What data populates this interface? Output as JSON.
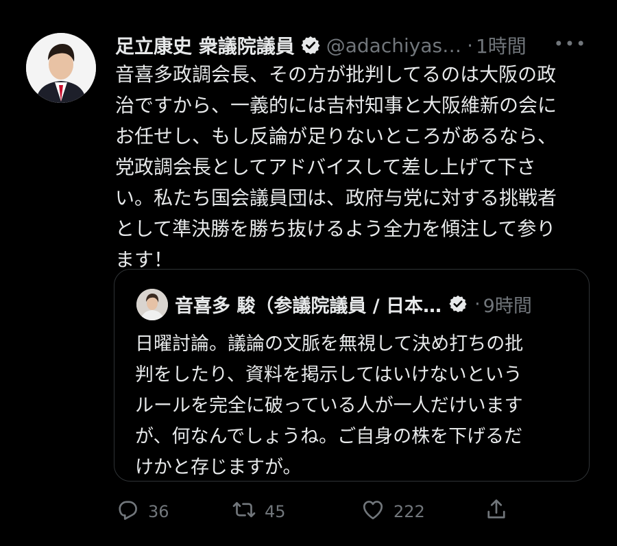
{
  "tweet": {
    "author_name": "足立康史 衆議院議員",
    "handle": "@adachiyas…",
    "dot": "·",
    "time": "1時間",
    "more": "•••",
    "text_lines": [
      "音喜多政調会長、その方が批判してるのは大阪の政",
      "治ですから、一義的には吉村知事と大阪維新の会に",
      "お任せし、もし反論が足りないところがあるなら、",
      "党政調会長としてアドバイスして差し上げて下さ",
      "い。私たち国会議員団は、政府与党に対する挑戦者",
      "として準決勝を勝ち抜けるよう全力を傾注して参り",
      "ます！"
    ]
  },
  "quote": {
    "author_name": "音喜多 駿（参議院議員 / 日本…",
    "dot": "·",
    "time": "9時間",
    "text_lines": [
      "日曜討論。議論の文脈を無視して決め打ちの批",
      "判をしたり、資料を掲示してはいけないという",
      "ルールを完全に破っている人が一人だけいます",
      "が、何なんでしょうね。ご自身の株を下げるだ",
      "けかと存じますが。"
    ]
  },
  "actions": {
    "reply_count": "36",
    "retweet_count": "45",
    "like_count": "222"
  },
  "icons": {
    "reply": "reply-icon",
    "retweet": "retweet-icon",
    "like": "heart-icon",
    "share": "share-icon",
    "verified": "verified-badge-icon",
    "more": "more-icon"
  },
  "colors": {
    "background": "#000000",
    "text": "#e7e9ea",
    "secondary": "#71767b",
    "border": "#2f3336"
  }
}
